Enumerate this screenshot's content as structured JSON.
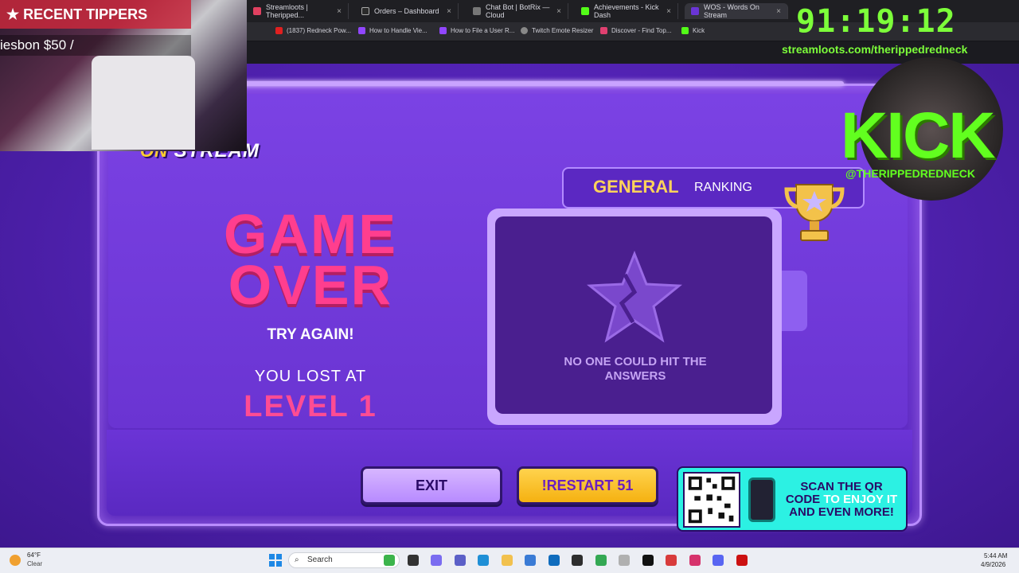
{
  "browser": {
    "tabs": [
      {
        "label": "Streamloots | Theripped...",
        "color": "#e04060"
      },
      {
        "label": "Orders – Dashboard",
        "color": "#2b2b2b"
      },
      {
        "label": "Chat Bot | BotRix — Cloud",
        "color": "#444444"
      },
      {
        "label": "Achievements - Kick Dash",
        "color": "#53fc18"
      },
      {
        "label": "WOS - Words On Stream",
        "color": "#6a35d6"
      }
    ],
    "bookmarks": [
      {
        "label": "(1837) Redneck Pow...",
        "color": "#e02020"
      },
      {
        "label": "How to Handle Vie...",
        "color": "#9146ff"
      },
      {
        "label": "How to File a User R...",
        "color": "#9146ff"
      },
      {
        "label": "Twitch Emote Resizer",
        "color": "#888888"
      },
      {
        "label": "Discover - Find Top...",
        "color": "#e04070"
      },
      {
        "label": "Kick",
        "color": "#53fc18"
      }
    ]
  },
  "overlay": {
    "tippers_title": "RECENT TIPPERS",
    "tipper_entry": "iesbon $50 /",
    "timer": "91:19:12",
    "url": "streamloots.com/therippedredneck",
    "kick_word": "KICK",
    "kick_handle": "@THERIPPEDREDNECK"
  },
  "game": {
    "logo_on": "ON",
    "logo_stream": "STREAM",
    "game_over": "GAME OVER",
    "try_again": "TRY AGAIN!",
    "lost_at": "YOU LOST AT",
    "level": "LEVEL 1",
    "ranking_title": "GENERAL",
    "ranking_sub": "RANKING",
    "no_one": "NO ONE COULD HIT THE ANSWERS",
    "exit_label": "EXIT",
    "restart_label": "!RESTART 51",
    "qr_line_a": "SCAN THE QR",
    "qr_line_b1": "CODE",
    "qr_line_b2": "TO ENJOY IT",
    "qr_line_c": "AND EVEN MORE!"
  },
  "taskbar": {
    "weather_temp": "64°F",
    "weather_cond": "Clear",
    "search_label": "Search",
    "time": "5:44 AM",
    "date": "4/9/2026",
    "icons": [
      {
        "name": "app-green-icon",
        "color": "#3cb44b"
      },
      {
        "name": "file-icon",
        "color": "#333333"
      },
      {
        "name": "copilot-icon",
        "color": "#7a6cf0"
      },
      {
        "name": "teams-icon",
        "color": "#5b5fc7"
      },
      {
        "name": "edge-icon",
        "color": "#1f8fd6"
      },
      {
        "name": "folder-icon",
        "color": "#f2c14e"
      },
      {
        "name": "store-icon",
        "color": "#3a7bd5"
      },
      {
        "name": "outlook-icon",
        "color": "#0f6cbd"
      },
      {
        "name": "obs-icon",
        "color": "#2e2e2e"
      },
      {
        "name": "chrome-icon",
        "color": "#34a853"
      },
      {
        "name": "app-light-icon",
        "color": "#b0b0b0"
      },
      {
        "name": "terminal-icon",
        "color": "#111111"
      },
      {
        "name": "app-red-icon",
        "color": "#d83b3b"
      },
      {
        "name": "app-pink-icon",
        "color": "#d6336c"
      },
      {
        "name": "discord-icon",
        "color": "#5865f2"
      },
      {
        "name": "app-record-icon",
        "color": "#cc1111"
      }
    ]
  }
}
